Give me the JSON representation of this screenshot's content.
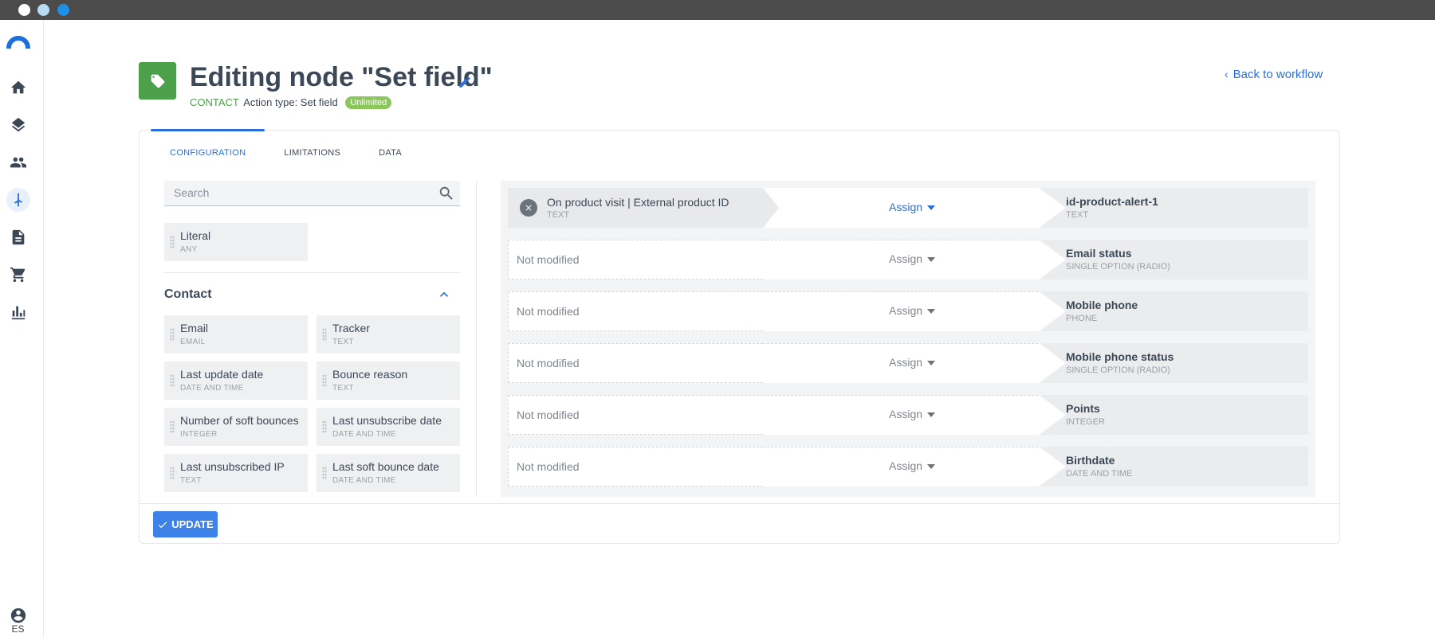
{
  "sidebar": {
    "items": [
      {
        "icon": "home-icon"
      },
      {
        "icon": "layers-icon"
      },
      {
        "icon": "contacts-icon"
      },
      {
        "icon": "workflow-icon",
        "active": true
      },
      {
        "icon": "document-icon"
      },
      {
        "icon": "cart-icon"
      },
      {
        "icon": "analytics-icon"
      }
    ],
    "user_lang": "ES"
  },
  "header": {
    "title": "Editing node \"Set field\"",
    "entity": "CONTACT",
    "action_type": "Action type: Set field",
    "badge": "Unlimited",
    "back_label": "Back to workflow"
  },
  "tabs": [
    "CONFIGURATION",
    "LIMITATIONS",
    "DATA"
  ],
  "search": {
    "placeholder": "Search"
  },
  "literal": {
    "name": "Literal",
    "type": "ANY"
  },
  "contact_section": {
    "title": "Contact",
    "fields": [
      {
        "name": "Email",
        "type": "EMAIL"
      },
      {
        "name": "Tracker",
        "type": "TEXT"
      },
      {
        "name": "Last update date",
        "type": "DATE AND TIME"
      },
      {
        "name": "Bounce reason",
        "type": "TEXT"
      },
      {
        "name": "Number of soft bounces",
        "type": "INTEGER"
      },
      {
        "name": "Last unsubscribe date",
        "type": "DATE AND TIME"
      },
      {
        "name": "Last unsubscribed IP",
        "type": "TEXT"
      },
      {
        "name": "Last soft bounce date",
        "type": "DATE AND TIME"
      }
    ]
  },
  "mappings": [
    {
      "source_name": "On product visit | External product ID",
      "source_type": "TEXT",
      "operation": "Assign",
      "target_name": "id-product-alert-1",
      "target_type": "TEXT"
    },
    {
      "source_empty": "Not modified",
      "operation": "Assign",
      "target_name": "Email status",
      "target_type": "SINGLE OPTION (RADIO)"
    },
    {
      "source_empty": "Not modified",
      "operation": "Assign",
      "target_name": "Mobile phone",
      "target_type": "PHONE"
    },
    {
      "source_empty": "Not modified",
      "operation": "Assign",
      "target_name": "Mobile phone status",
      "target_type": "SINGLE OPTION (RADIO)"
    },
    {
      "source_empty": "Not modified",
      "operation": "Assign",
      "target_name": "Points",
      "target_type": "INTEGER"
    },
    {
      "source_empty": "Not modified",
      "operation": "Assign",
      "target_name": "Birthdate",
      "target_type": "DATE AND TIME"
    }
  ],
  "footer": {
    "update_label": "UPDATE"
  },
  "colors": {
    "accent": "#2a6fdb",
    "brand_green": "#4da04a",
    "badge_green": "#8bc85b"
  }
}
